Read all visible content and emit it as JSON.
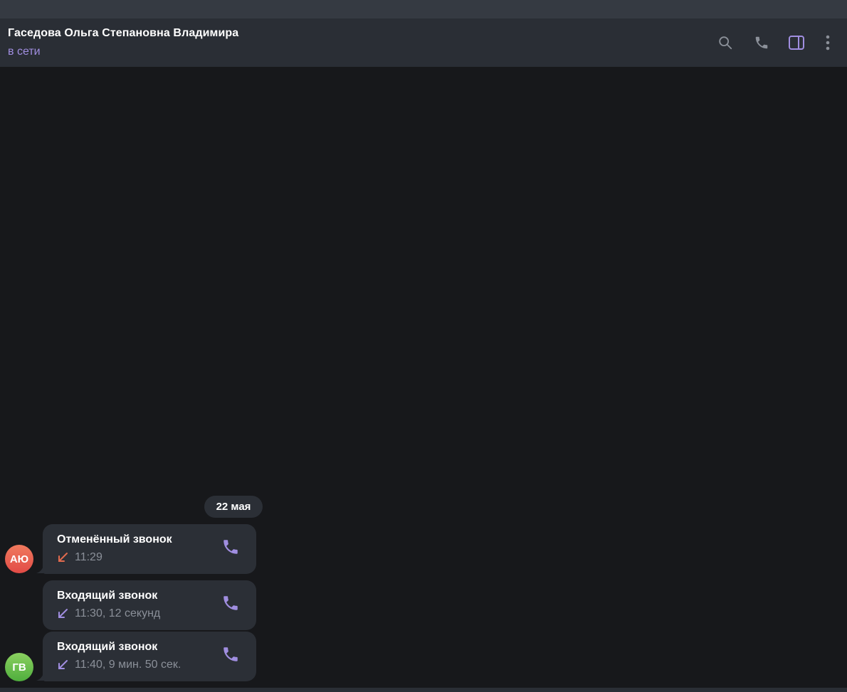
{
  "header": {
    "title": "Гаседова Ольга Степановна Владимира",
    "status": "в сети",
    "buttons": [
      {
        "name": "search",
        "icon": "search-icon"
      },
      {
        "name": "call",
        "icon": "phone-icon"
      },
      {
        "name": "sidebar",
        "icon": "sidebar-panel-icon"
      },
      {
        "name": "more",
        "icon": "more-vertical-icon"
      }
    ]
  },
  "colors": {
    "accent": "#a08ee0",
    "missed": "#e06a4e",
    "bubble_bg": "#2b2f36",
    "chat_bg": "#17181b",
    "header_bg": "#2a2e35"
  },
  "chat": {
    "date_separator": "22 мая",
    "messages": [
      {
        "avatar": "АЮ",
        "title": "Отменённый звонок",
        "meta": "11:29",
        "arrow_icon": "incoming-arrow-icon",
        "arrow_color": "#e06a4e",
        "call_icon": "phone-icon"
      },
      {
        "avatar": "",
        "title": "Входящий звонок",
        "meta": "11:30, 12 секунд",
        "arrow_icon": "incoming-arrow-icon",
        "arrow_color": "#a08ee0",
        "call_icon": "phone-icon"
      },
      {
        "avatar": "ГВ",
        "title": "Входящий звонок",
        "meta": "11:40, 9 мин. 50 сек.",
        "arrow_icon": "incoming-arrow-icon",
        "arrow_color": "#a08ee0",
        "call_icon": "phone-icon"
      }
    ]
  }
}
